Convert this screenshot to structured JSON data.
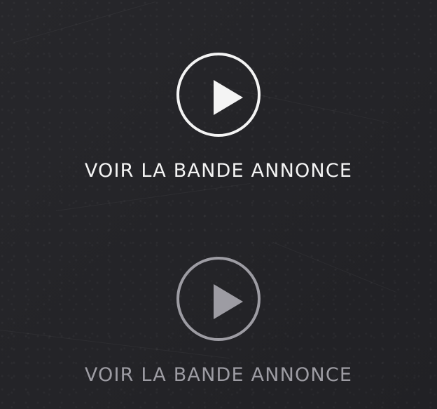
{
  "trailer_links": [
    {
      "label": "VOIR LA BANDE ANNONCE",
      "icon": "play-icon",
      "state": "default",
      "color": "#f4f4f4"
    },
    {
      "label": "VOIR LA BANDE ANNONCE",
      "icon": "play-icon",
      "state": "hover",
      "color": "#9d9ca3"
    }
  ]
}
